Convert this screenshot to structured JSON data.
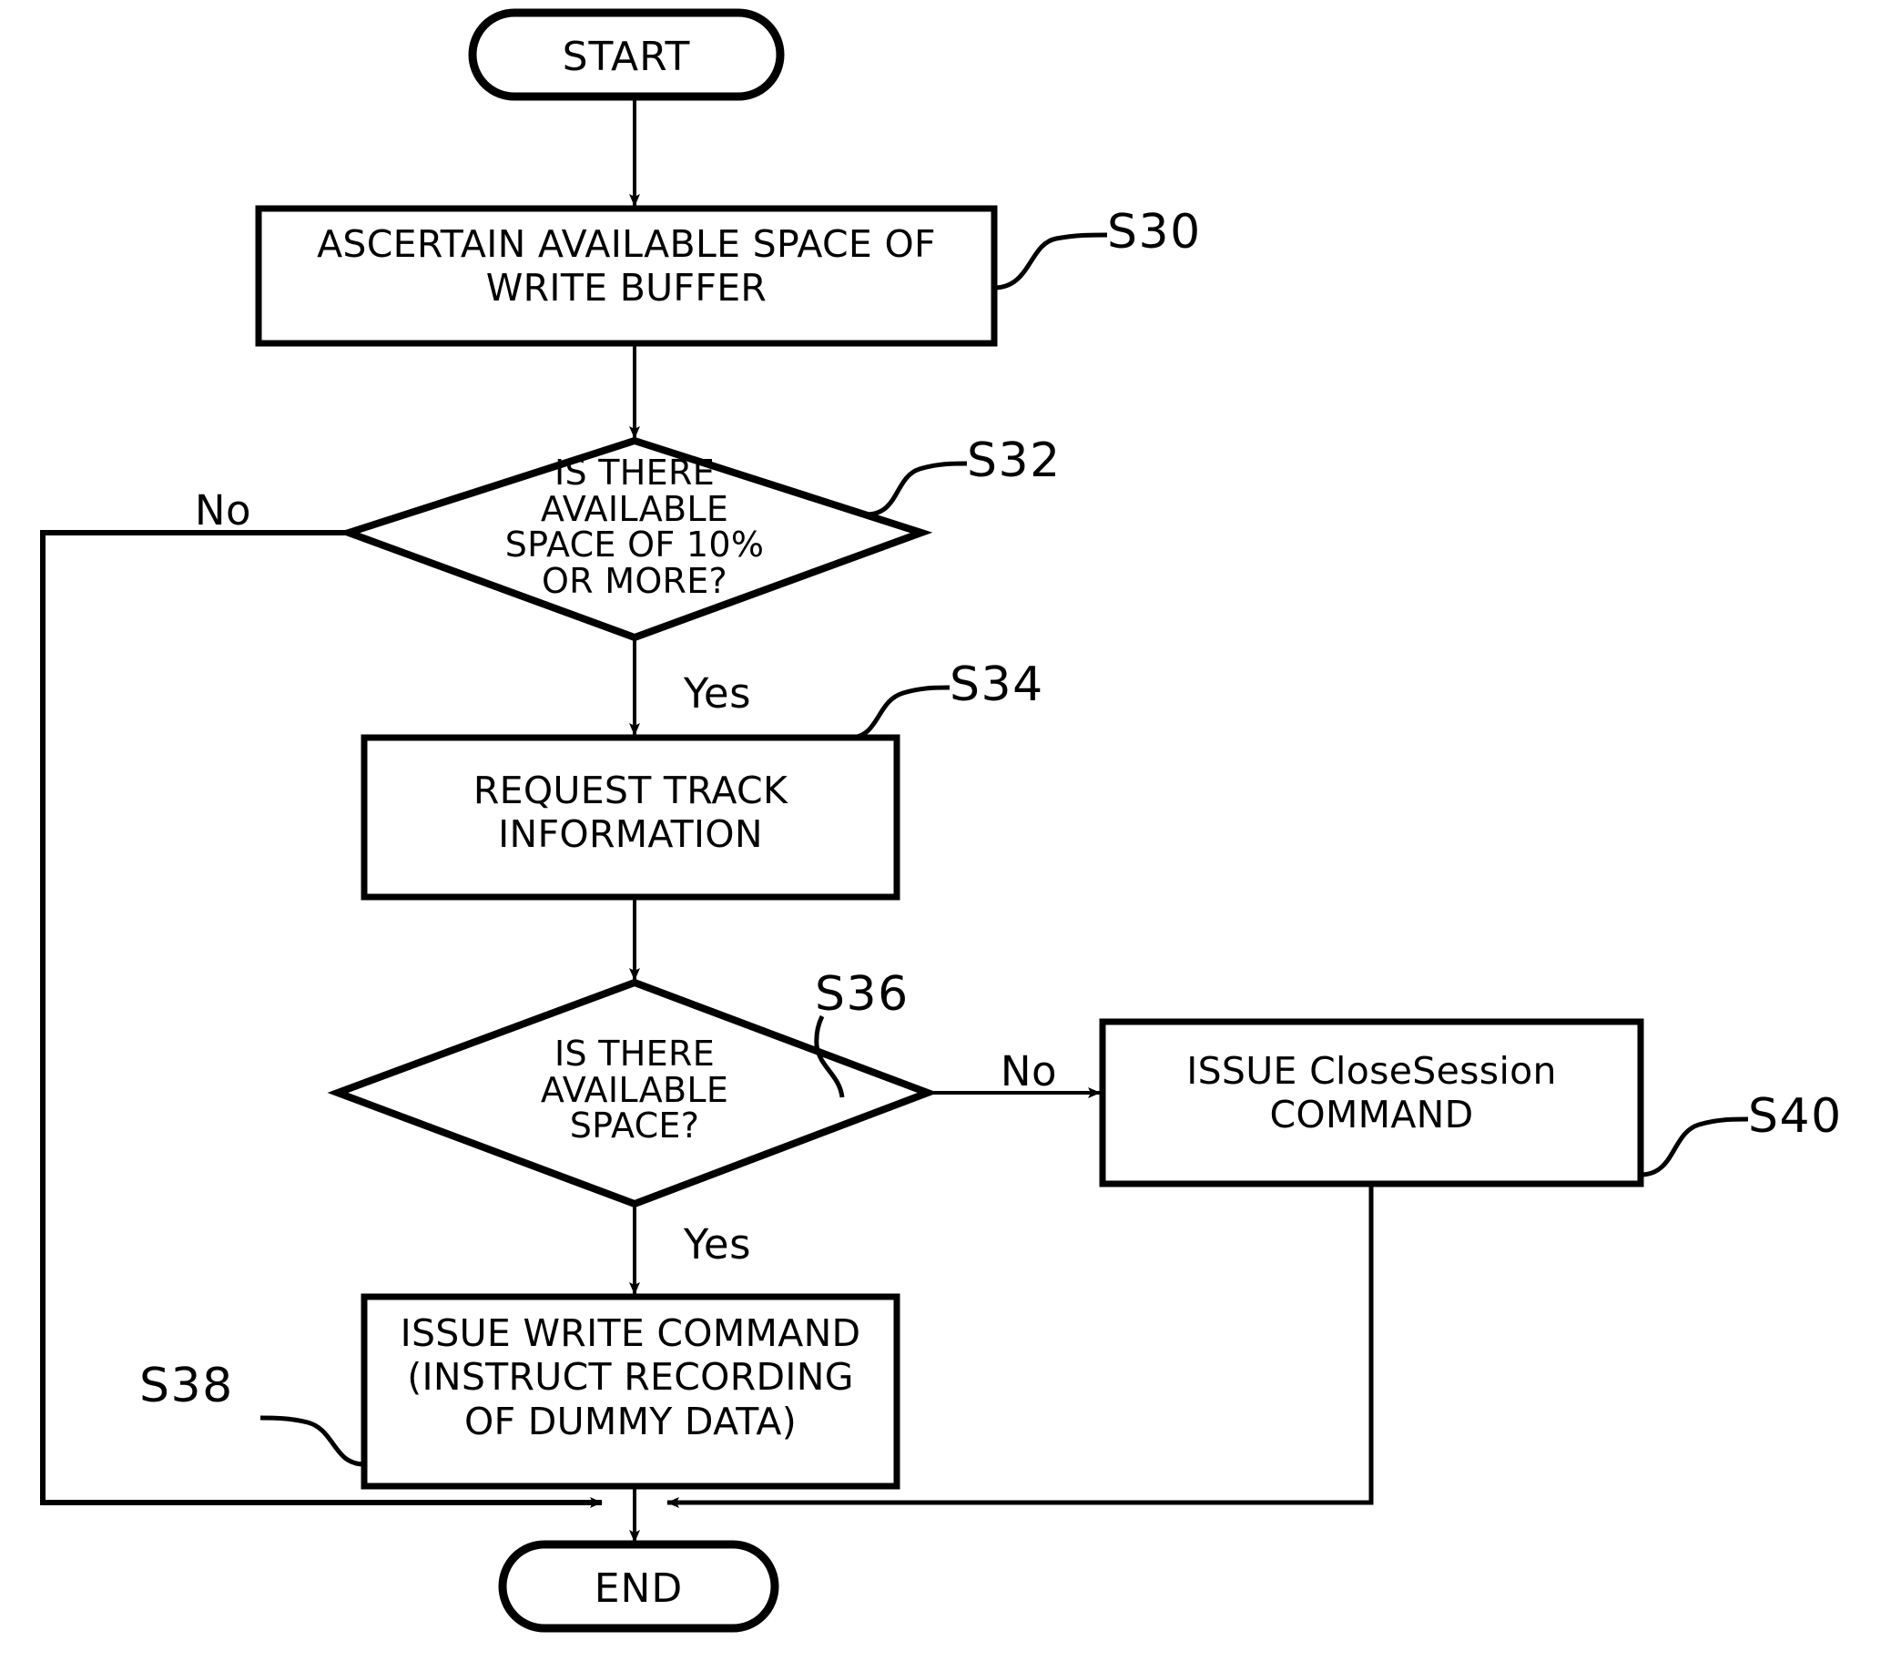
{
  "diagram": {
    "type": "flowchart",
    "title": "",
    "nodes": {
      "start": {
        "label": "START",
        "shape": "terminal"
      },
      "s30": {
        "label": "ASCERTAIN AVAILABLE SPACE OF\nWRITE BUFFER",
        "shape": "process",
        "ref": "S30"
      },
      "s32": {
        "label": "IS THERE\nAVAILABLE\nSPACE OF 10%\nOR MORE?",
        "shape": "decision",
        "ref": "S32"
      },
      "s34": {
        "label": "REQUEST TRACK\nINFORMATION",
        "shape": "process",
        "ref": "S34"
      },
      "s36": {
        "label": "IS THERE\nAVAILABLE\nSPACE?",
        "shape": "decision",
        "ref": "S36"
      },
      "s38": {
        "label": "ISSUE WRITE COMMAND\n(INSTRUCT RECORDING\nOF DUMMY DATA)",
        "shape": "process",
        "ref": "S38"
      },
      "s40": {
        "label": "ISSUE CloseSession\nCOMMAND",
        "shape": "process",
        "ref": "S40"
      },
      "end": {
        "label": "END",
        "shape": "terminal"
      }
    },
    "branch_labels": {
      "s32_no": "No",
      "s32_yes": "Yes",
      "s36_no": "No",
      "s36_yes": "Yes"
    },
    "edges": [
      {
        "from": "start",
        "to": "s30",
        "label": ""
      },
      {
        "from": "s30",
        "to": "s32",
        "label": ""
      },
      {
        "from": "s32",
        "to": "s34",
        "label": "Yes"
      },
      {
        "from": "s32",
        "to": "end",
        "label": "No"
      },
      {
        "from": "s34",
        "to": "s36",
        "label": ""
      },
      {
        "from": "s36",
        "to": "s38",
        "label": "Yes"
      },
      {
        "from": "s36",
        "to": "s40",
        "label": "No"
      },
      {
        "from": "s38",
        "to": "end",
        "label": ""
      },
      {
        "from": "s40",
        "to": "end",
        "label": ""
      }
    ],
    "colors": {
      "stroke": "#000000",
      "background": "#ffffff",
      "text": "#000000"
    }
  }
}
